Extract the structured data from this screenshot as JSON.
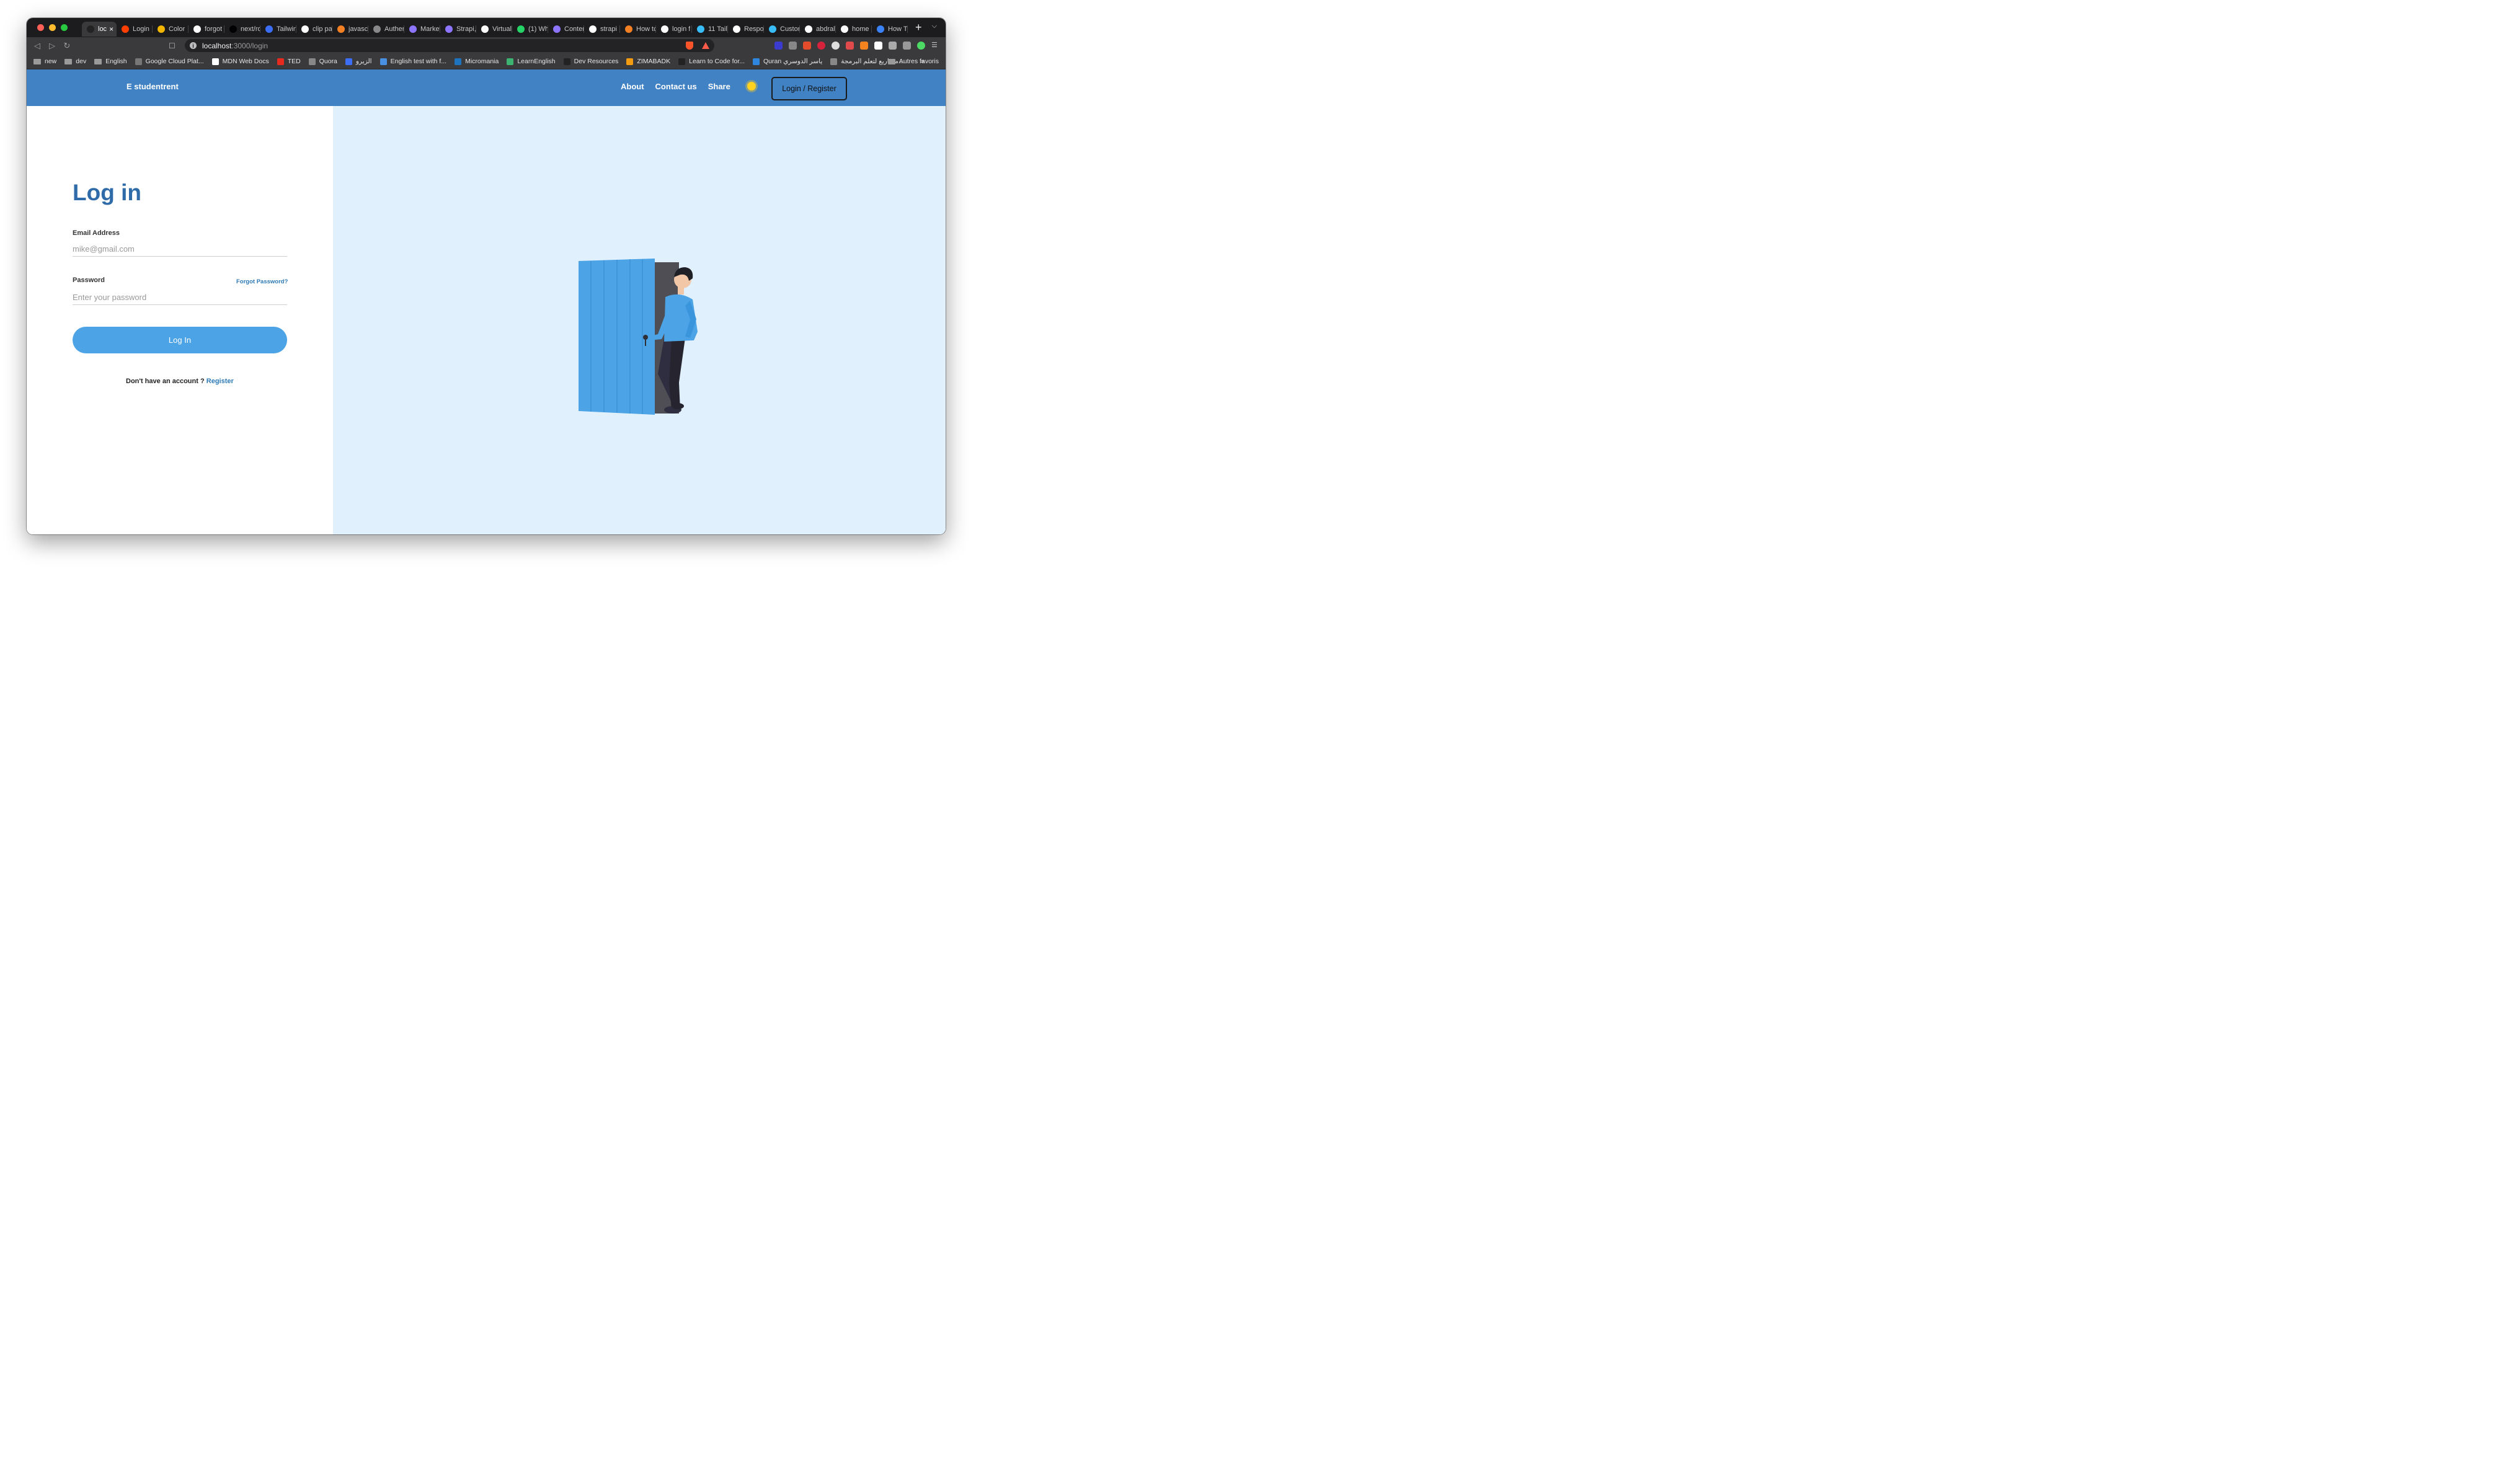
{
  "browser": {
    "tabs": [
      {
        "title": "loc",
        "favicon": "vercel-icon",
        "color": "#222222",
        "active": true
      },
      {
        "title": "Login",
        "favicon": "svelte-icon",
        "color": "#ff3e00"
      },
      {
        "title": "Color",
        "favicon": "palette-icon",
        "color": "#f2b600"
      },
      {
        "title": "forgot",
        "favicon": "google-icon",
        "color": "#ffffff"
      },
      {
        "title": "next/ro",
        "favicon": "next-icon",
        "color": "#000000"
      },
      {
        "title": "Tailwin",
        "favicon": "tailwind-icon",
        "color": "#3b6ef5"
      },
      {
        "title": "clip pa",
        "favicon": "google-icon",
        "color": "#ffffff"
      },
      {
        "title": "javasc",
        "favicon": "stackoverflow-icon",
        "color": "#f48024"
      },
      {
        "title": "Auther",
        "favicon": "globe-icon",
        "color": "#888888"
      },
      {
        "title": "Market",
        "favicon": "strapi-icon",
        "color": "#8e75ff"
      },
      {
        "title": "Strapi,",
        "favicon": "strapi-icon",
        "color": "#8e75ff"
      },
      {
        "title": "Virtual",
        "favicon": "github-icon",
        "color": "#ffffff"
      },
      {
        "title": "(1) Wh",
        "favicon": "whatsapp-icon",
        "color": "#25d366"
      },
      {
        "title": "Conter",
        "favicon": "strapi-icon",
        "color": "#8e75ff"
      },
      {
        "title": "strapi",
        "favicon": "google-icon",
        "color": "#ffffff"
      },
      {
        "title": "How tc",
        "favicon": "stackoverflow-icon",
        "color": "#f48024"
      },
      {
        "title": "login f",
        "favicon": "google-icon",
        "color": "#ffffff"
      },
      {
        "title": "11 Tail",
        "favicon": "tailwind-icon",
        "color": "#38bdf8"
      },
      {
        "title": "Respo",
        "favicon": "codepen-icon",
        "color": "#ffffff"
      },
      {
        "title": "Custor",
        "favicon": "tailwind-icon",
        "color": "#38bdf8"
      },
      {
        "title": "abdral",
        "favicon": "github-icon",
        "color": "#ffffff"
      },
      {
        "title": "home",
        "favicon": "google-icon",
        "color": "#ffffff"
      },
      {
        "title": "How T",
        "favicon": "loop-icon",
        "color": "#3b82f6"
      }
    ],
    "url_host": "localhost",
    "url_path": ":3000/login",
    "bookmarks": [
      {
        "label": "new",
        "icon": "folder-icon",
        "color": "#9a9a9a"
      },
      {
        "label": "dev",
        "icon": "folder-icon",
        "color": "#9a9a9a"
      },
      {
        "label": "English",
        "icon": "folder-icon",
        "color": "#9a9a9a"
      },
      {
        "label": "Google Cloud Plat...",
        "icon": "cloud-icon",
        "color": "#777777"
      },
      {
        "label": "MDN Web Docs",
        "icon": "mdn-icon",
        "color": "#ffffff"
      },
      {
        "label": "TED",
        "icon": "ted-icon",
        "color": "#e62b1e"
      },
      {
        "label": "Quora",
        "icon": "globe-icon",
        "color": "#888888"
      },
      {
        "label": "الزيرو",
        "icon": "e-icon",
        "color": "#3b6ef5"
      },
      {
        "label": "English test with f...",
        "icon": "ef-icon",
        "color": "#4a90e2"
      },
      {
        "label": "Micromania",
        "icon": "micromania-icon",
        "color": "#1e73be"
      },
      {
        "label": "LearnEnglish",
        "icon": "clover-icon",
        "color": "#3cb371"
      },
      {
        "label": "Dev Resources",
        "icon": "dr-icon",
        "color": "#222222"
      },
      {
        "label": "ZIMABADK",
        "icon": "z-icon",
        "color": "#f39c12"
      },
      {
        "label": "Learn to Code for...",
        "icon": "freecodecamp-icon",
        "color": "#222222"
      },
      {
        "label": "Quran ياسر الدوسري",
        "icon": "quran-icon",
        "color": "#2e86de"
      },
      {
        "label": "مشاريع لتعلم البرمجة...",
        "icon": "globe-icon",
        "color": "#888888"
      }
    ],
    "bookmarks_more": "»",
    "other_bookmarks": "Autres favoris"
  },
  "site": {
    "brand": "E studentrent",
    "nav": [
      "About",
      "Contact us",
      "Share"
    ],
    "theme_icon": "sun-icon",
    "login_register": "Login / Register"
  },
  "login": {
    "title": "Log in",
    "email_label": "Email Address",
    "email_placeholder": "mike@gmail.com",
    "password_label": "Password",
    "password_placeholder": "Enter your password",
    "forgot": "Forgot Password?",
    "submit": "Log In",
    "no_account": "Don't have an account ?",
    "register": "Register"
  },
  "colors": {
    "navbar": "#4182c4",
    "accent": "#4ca3e6",
    "heading": "#2f6ba8",
    "illustration_bg": "#e0f0fd"
  }
}
